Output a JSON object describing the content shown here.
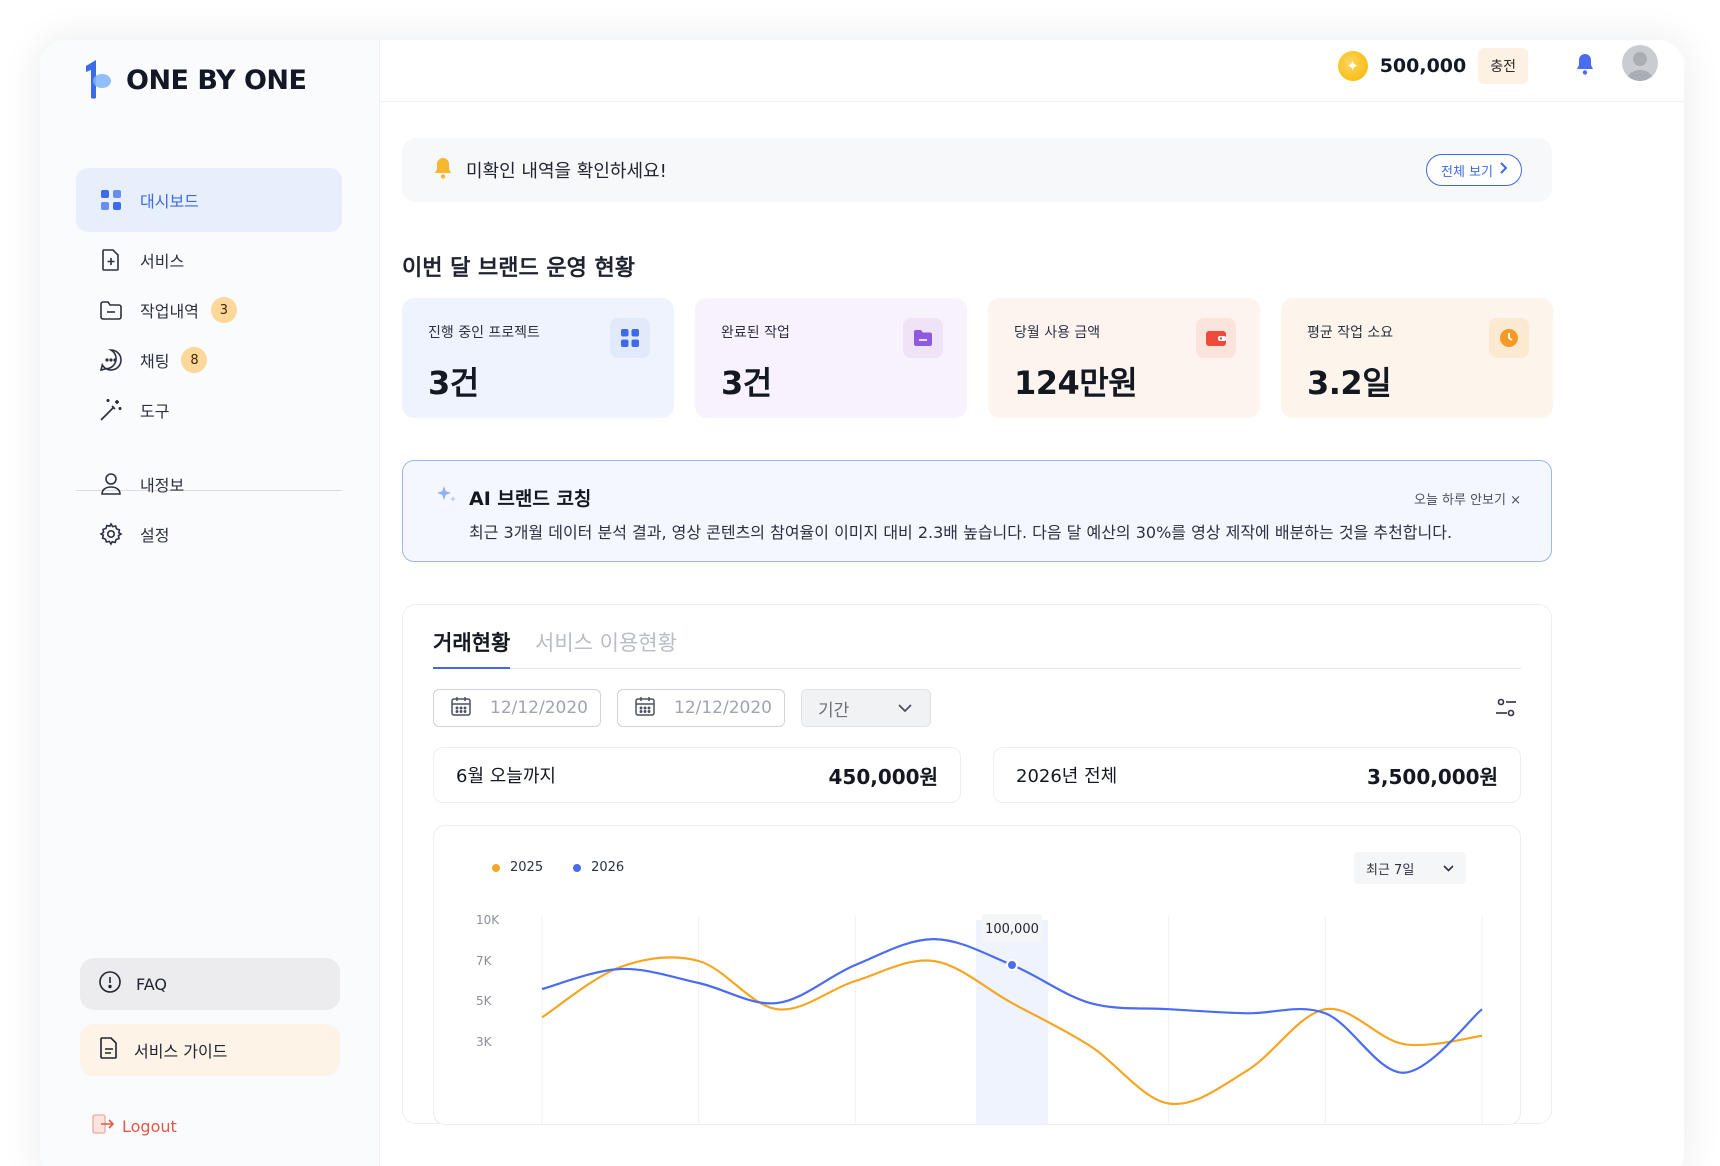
{
  "brand": {
    "name": "ONE BY ONE"
  },
  "sidebar": {
    "items": [
      {
        "label": "대시보드",
        "icon": "grid-icon",
        "active": true
      },
      {
        "label": "서비스",
        "icon": "file-plus-icon"
      },
      {
        "label": "작업내역",
        "icon": "folder-icon",
        "badge": "3"
      },
      {
        "label": "채팅",
        "icon": "chat-icon",
        "badge": "8"
      },
      {
        "label": "도구",
        "icon": "magic-wand-icon"
      },
      {
        "label": "내정보",
        "icon": "user-icon"
      },
      {
        "label": "설정",
        "icon": "gear-icon"
      }
    ],
    "faq_label": "FAQ",
    "guide_label": "서비스 가이드",
    "logout_label": "Logout"
  },
  "topbar": {
    "balance": "500,000",
    "charge_label": "충전"
  },
  "alert": {
    "text": "미확인 내역을 확인하세요!",
    "view_all": "전체 보기"
  },
  "overview": {
    "title": "이번 달 브랜드 운영 현황",
    "cards": [
      {
        "label": "진행 중인 프로젝트",
        "value": "3건",
        "icon": "grid-icon"
      },
      {
        "label": "완료된 작업",
        "value": "3건",
        "icon": "folder-icon"
      },
      {
        "label": "당월 사용 금액",
        "value": "124만원",
        "icon": "wallet-icon"
      },
      {
        "label": "평균 작업 소요",
        "value": "3.2일",
        "icon": "clock-icon"
      }
    ]
  },
  "ai_coach": {
    "title": "AI 브랜드 코칭",
    "dismiss": "오늘 하루 안보기 ×",
    "message": "최근 3개월 데이터 분석 결과, 영상 콘텐츠의 참여율이 이미지 대비 2.3배 높습니다. 다음 달 예산의 30%를 영상 제작에 배분하는 것을 추천합니다."
  },
  "transactions": {
    "tabs": [
      "거래현황",
      "서비스 이용현황"
    ],
    "date_from": "12/12/2020",
    "date_to": "12/12/2020",
    "period_label": "기간",
    "summary": [
      {
        "label": "6월 오늘까지",
        "value": "450,000원"
      },
      {
        "label": "2026년 전체",
        "value": "3,500,000원"
      }
    ],
    "range_label": "최근 7일"
  },
  "colors": {
    "accent": "#3d6ae8",
    "series_2025": "#f5a623",
    "series_2026": "#4a6cf0"
  },
  "chart_data": {
    "type": "line",
    "y_ticks": [
      "10K",
      "7K",
      "5K",
      "3K"
    ],
    "ylim": [
      0,
      10000
    ],
    "series": [
      {
        "name": "2025",
        "values": [
          4200,
          6700,
          7000,
          4600,
          6000,
          7000,
          4900,
          2800,
          0,
          1600,
          4600,
          2900,
          3300
        ]
      },
      {
        "name": "2026",
        "values": [
          5600,
          6600,
          5900,
          4900,
          6800,
          8600,
          6800,
          4900,
          4600,
          4400,
          4400,
          1500,
          4600
        ]
      }
    ],
    "tooltip": {
      "value": "100,000"
    },
    "grid": true,
    "legend": "top-left"
  }
}
